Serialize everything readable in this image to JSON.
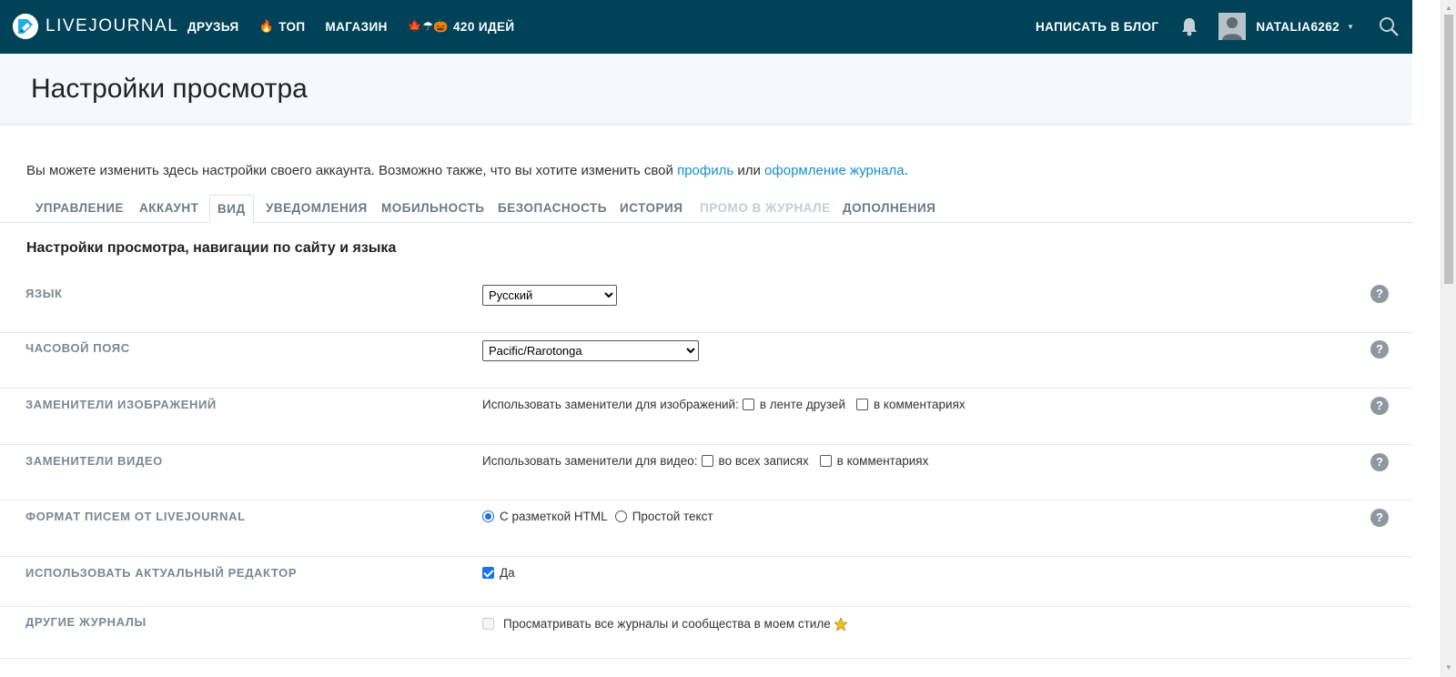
{
  "topbar": {
    "logo_text": "LIVEJOURNAL",
    "nav": [
      {
        "label": "ДРУЗЬЯ",
        "emoji": ""
      },
      {
        "label": "ТОП",
        "emoji": "🔥"
      },
      {
        "label": "МАГАЗИН",
        "emoji": ""
      },
      {
        "label": "420 ИДЕЙ",
        "emoji": "🍁☂🎃"
      }
    ],
    "write_label": "НАПИСАТЬ В БЛОГ",
    "username": "NATALIA6262"
  },
  "page": {
    "title": "Настройки просмотра",
    "intro_prefix": "Вы можете изменить здесь настройки своего аккаунта. Возможно также, что вы хотите изменить свой ",
    "intro_link1": "профиль",
    "intro_mid": " или ",
    "intro_link2": "оформление журнала",
    "intro_suffix": "."
  },
  "tabs": [
    {
      "label": "УПРАВЛЕНИЕ"
    },
    {
      "label": "АККАУНТ"
    },
    {
      "label": "ВИД",
      "active": true
    },
    {
      "label": "УВЕДОМЛЕНИЯ"
    },
    {
      "label": "МОБИЛЬНОСТЬ"
    },
    {
      "label": "БЕЗОПАСНОСТЬ"
    },
    {
      "label": "ИСТОРИЯ"
    },
    {
      "label": "ПРОМО В ЖУРНАЛЕ",
      "disabled": true
    },
    {
      "label": "ДОПОЛНЕНИЯ"
    }
  ],
  "section_title": "Настройки просмотра, навигации по сайту и языка",
  "settings": {
    "language": {
      "label": "ЯЗЫК",
      "value": "Русский"
    },
    "timezone": {
      "label": "ЧАСОВОЙ ПОЯС",
      "value": "Pacific/Rarotonga"
    },
    "image_placeholders": {
      "label": "ЗАМЕНИТЕЛИ ИЗОБРАЖЕНИЙ",
      "prompt": "Использовать заменители для изображений:",
      "opt1": "в ленте друзей",
      "opt2": "в комментариях"
    },
    "video_placeholders": {
      "label": "ЗАМЕНИТЕЛИ ВИДЕО",
      "prompt": "Использовать заменители для видео:",
      "opt1": "во всех записях",
      "opt2": "в комментариях"
    },
    "email_format": {
      "label": "ФОРМАТ ПИСЕМ ОТ LIVEJOURNAL",
      "opt1": "С разметкой HTML",
      "opt2": "Простой текст"
    },
    "editor": {
      "label": "ИСПОЛЬЗОВАТЬ АКТУАЛЬНЫЙ РЕДАКТОР",
      "opt": "Да"
    },
    "other_journals": {
      "label": "ДРУГИЕ ЖУРНАЛЫ",
      "opt": "Просматривать все журналы и сообщества в моем стиле"
    },
    "help_glyph": "?"
  },
  "colors": {
    "topbar": "#004359",
    "link": "#1b8fc5",
    "accent": "#1a73e8"
  }
}
